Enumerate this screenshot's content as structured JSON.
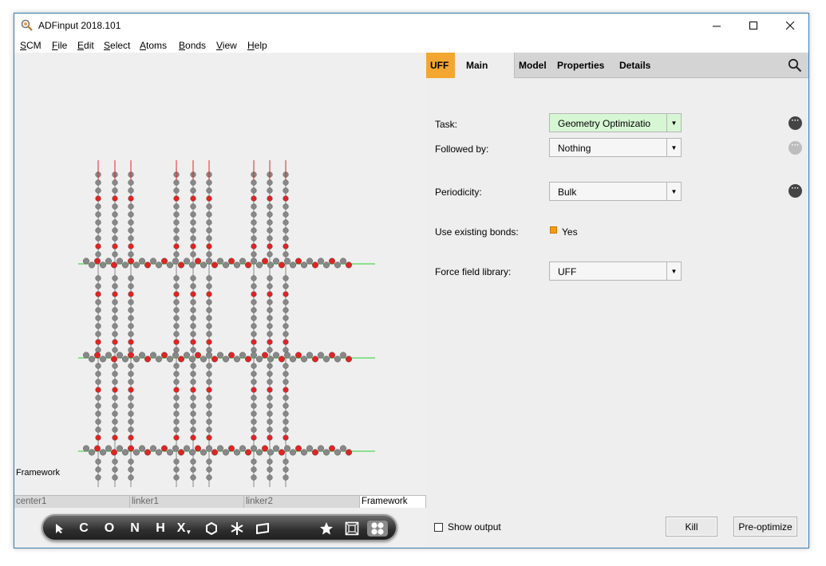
{
  "window": {
    "title": "ADFinput 2018.101"
  },
  "menu": [
    "SCM",
    "File",
    "Edit",
    "Select",
    "Atoms",
    "Bonds",
    "View",
    "Help"
  ],
  "viewer": {
    "region_label": "Framework",
    "tabs": [
      "center1",
      "linker1",
      "linker2",
      "Framework"
    ],
    "toolbar": {
      "tools": [
        "C",
        "O",
        "N",
        "H",
        "X"
      ],
      "icons": [
        "pointer-icon",
        "hexagon-icon",
        "snowflake-icon",
        "plane-icon",
        "star-icon",
        "cube-icon",
        "molecule-icon"
      ]
    }
  },
  "nav": {
    "engine": "UFF",
    "active": "Main",
    "links": [
      "Model",
      "Properties",
      "Details"
    ]
  },
  "form": {
    "task": {
      "label": "Task:",
      "value": "Geometry Optimizatio"
    },
    "followed_by": {
      "label": "Followed by:",
      "value": "Nothing"
    },
    "periodicity": {
      "label": "Periodicity:",
      "value": "Bulk"
    },
    "use_existing_bonds": {
      "label": "Use existing bonds:",
      "value": "Yes"
    },
    "force_field": {
      "label": "Force field library:",
      "value": "UFF"
    }
  },
  "footer": {
    "show_output": "Show output",
    "kill": "Kill",
    "preoptimize": "Pre-optimize"
  },
  "colors": {
    "accent": "#f3a730",
    "highlight": "#d7f7d4"
  }
}
